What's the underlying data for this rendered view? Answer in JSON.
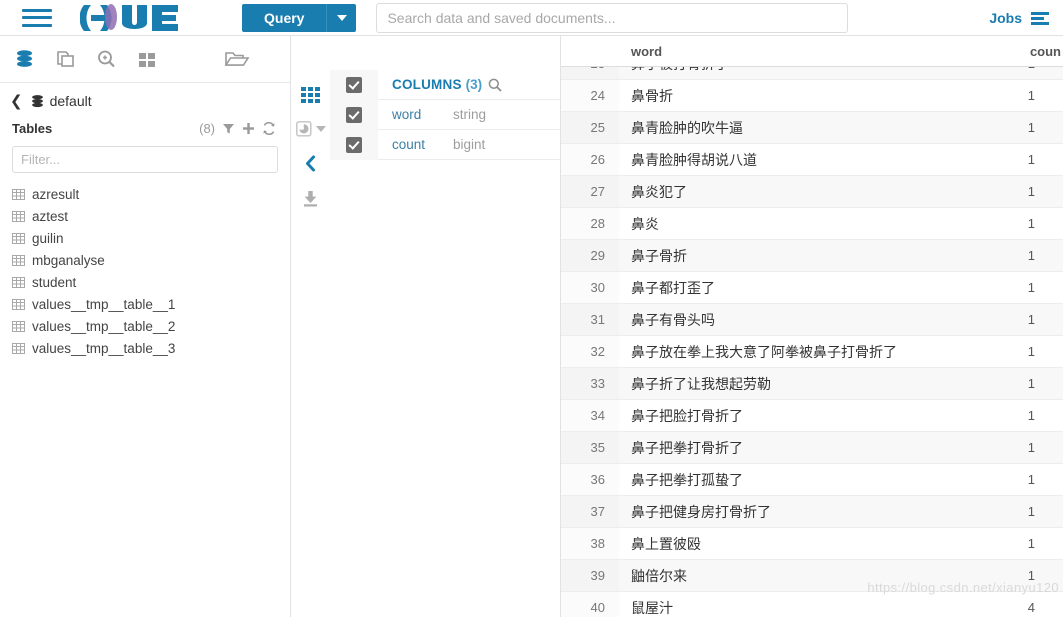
{
  "topnav": {
    "menu_icon": "hamburger-icon",
    "logo_text": "hue",
    "query_button": "Query",
    "query_caret": "chevron-down-icon",
    "search_placeholder": "Search data and saved documents...",
    "search_value": "",
    "jobs_label": "Jobs",
    "jobs_icon": "jobs-list-icon"
  },
  "assist": {
    "icons": [
      {
        "name": "database-icon",
        "active": true
      },
      {
        "name": "documents-icon",
        "active": false
      },
      {
        "name": "search-plus-icon",
        "active": false
      },
      {
        "name": "grid-apps-icon",
        "active": false
      }
    ],
    "folder_icon": "open-folder-icon",
    "back_chevron": "chevron-left-icon",
    "database_icon": "database-icon",
    "database_name": "default",
    "tables_label": "Tables",
    "tables_count": "(8)",
    "tables_actions": [
      "filter-funnel-icon",
      "plus-icon",
      "refresh-icon"
    ],
    "filter_placeholder": "Filter...",
    "filter_value": "",
    "tables": [
      "azresult",
      "aztest",
      "guilin",
      "mbganalyse",
      "student",
      "values__tmp__table__1",
      "values__tmp__table__2",
      "values__tmp__table__3"
    ]
  },
  "rail": {
    "icons": [
      {
        "name": "grid-results-icon",
        "active": true
      },
      {
        "name": "chart-icon",
        "active": false
      },
      {
        "name": "collapse-left-icon",
        "active": true
      },
      {
        "name": "download-icon",
        "active": false
      }
    ]
  },
  "columns_panel": {
    "title": "COLUMNS",
    "count": "(3)",
    "search_icon": "search-icon",
    "header_checked": true,
    "columns": [
      {
        "name": "word",
        "type": "string",
        "checked": true
      },
      {
        "name": "count",
        "type": "bigint",
        "checked": true
      }
    ]
  },
  "results": {
    "headers": {
      "row_num": "",
      "word": "word",
      "count": "coun"
    },
    "rows": [
      {
        "num": "24",
        "word": "鼻骨折",
        "count": "1"
      },
      {
        "num": "25",
        "word": "鼻青脸肿的吹牛逼",
        "count": "1"
      },
      {
        "num": "26",
        "word": "鼻青脸肿得胡说八道",
        "count": "1"
      },
      {
        "num": "27",
        "word": "鼻炎犯了",
        "count": "1"
      },
      {
        "num": "28",
        "word": "鼻炎",
        "count": "1"
      },
      {
        "num": "29",
        "word": "鼻子骨折",
        "count": "1"
      },
      {
        "num": "30",
        "word": "鼻子都打歪了",
        "count": "1"
      },
      {
        "num": "31",
        "word": "鼻子有骨头吗",
        "count": "1"
      },
      {
        "num": "32",
        "word": "鼻子放在拳上我大意了阿拳被鼻子打骨折了",
        "count": "1"
      },
      {
        "num": "33",
        "word": "鼻子折了让我想起劳勒",
        "count": "1"
      },
      {
        "num": "34",
        "word": "鼻子把脸打骨折了",
        "count": "1"
      },
      {
        "num": "35",
        "word": "鼻子把拳打骨折了",
        "count": "1"
      },
      {
        "num": "36",
        "word": "鼻子把拳打孤蛰了",
        "count": "1"
      },
      {
        "num": "37",
        "word": "鼻子把健身房打骨折了",
        "count": "1"
      },
      {
        "num": "38",
        "word": "鼻上置彼殴",
        "count": "1"
      },
      {
        "num": "39",
        "word": "鼬倍尔来",
        "count": "1"
      },
      {
        "num": "40",
        "word": "鼠屋汁",
        "count": "4"
      }
    ]
  },
  "watermark": "https://blog.csdn.net/xianyu120",
  "colors": {
    "brand_blue": "#1a7db0",
    "link_blue": "#3b7fa6",
    "panel_border": "#e2e2e2",
    "row_alt": "#f8f8f8"
  }
}
